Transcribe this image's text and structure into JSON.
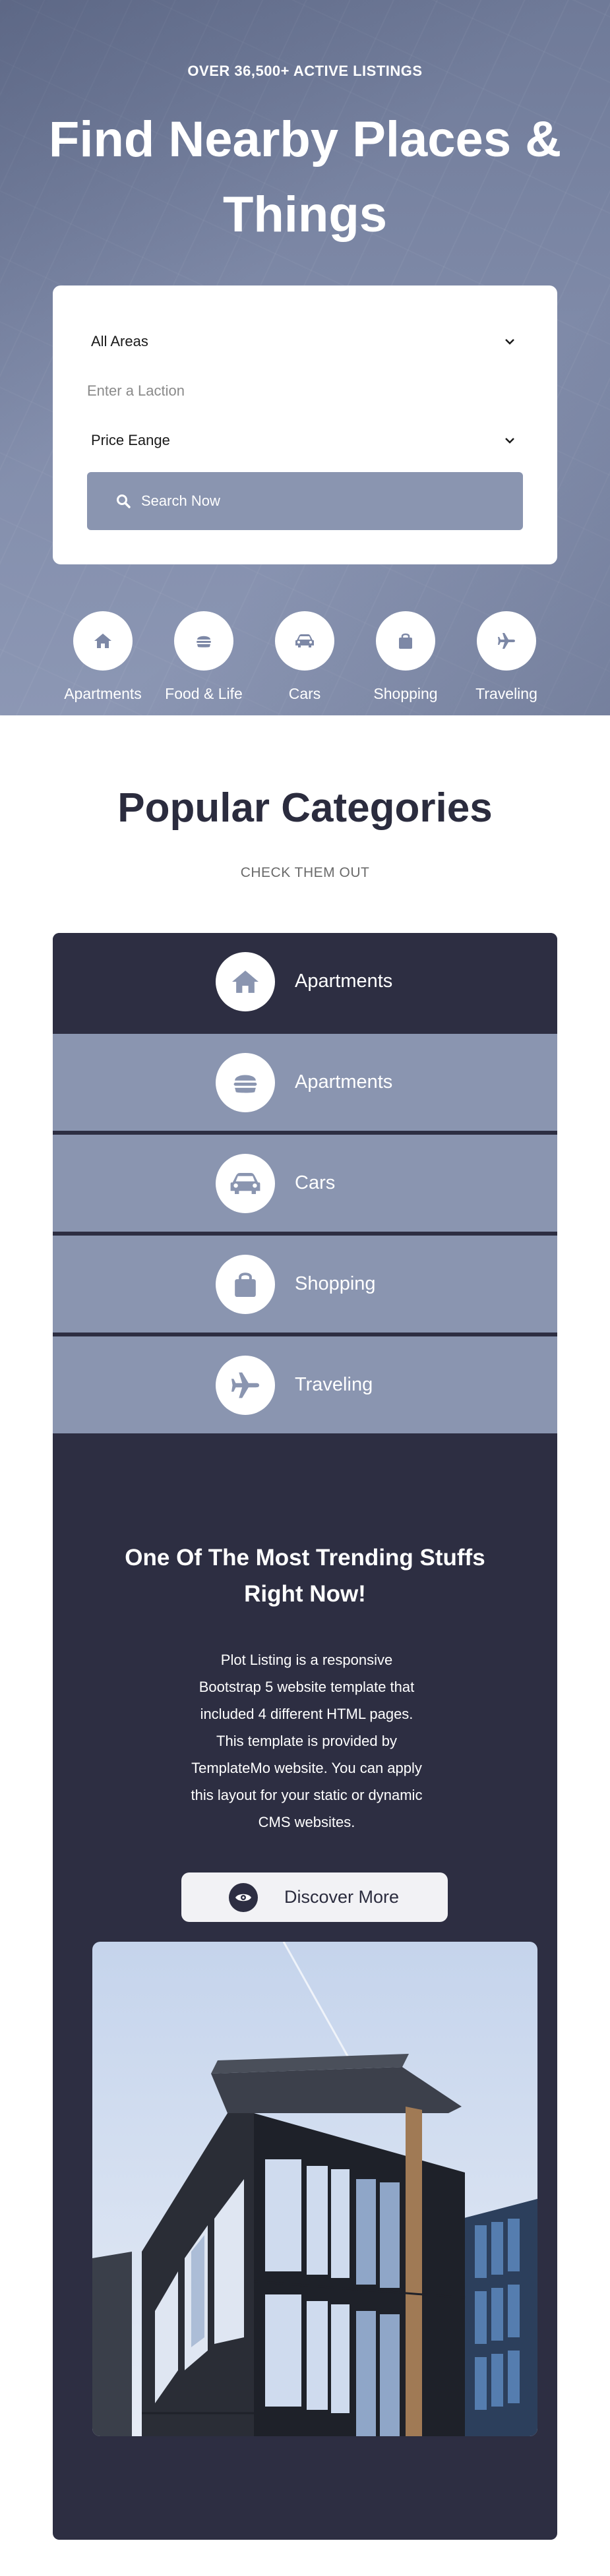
{
  "hero": {
    "eyebrow": "OVER 36,500+ ACTIVE LISTINGS",
    "title": "Find Nearby Places & Things"
  },
  "search_form": {
    "area_select": "All Areas",
    "location_placeholder": "Enter a Laction",
    "price_select": "Price Eange",
    "search_button": "Search Now"
  },
  "hero_categories": [
    {
      "label": "Apartments",
      "icon": "home-icon"
    },
    {
      "label": "Food & Life",
      "icon": "burger-icon"
    },
    {
      "label": "Cars",
      "icon": "car-icon"
    },
    {
      "label": "Shopping",
      "icon": "shopping-bag-icon"
    },
    {
      "label": "Traveling",
      "icon": "plane-icon"
    }
  ],
  "popular": {
    "title": "Popular Categories",
    "subtitle": "CHECK THEM OUT",
    "tabs": [
      {
        "label": "Apartments",
        "icon": "home-icon",
        "active": true
      },
      {
        "label": "Apartments",
        "icon": "burger-icon",
        "active": false
      },
      {
        "label": "Cars",
        "icon": "car-icon",
        "active": false
      },
      {
        "label": "Shopping",
        "icon": "shopping-bag-icon",
        "active": false
      },
      {
        "label": "Traveling",
        "icon": "plane-icon",
        "active": false
      }
    ],
    "content": {
      "heading": "One Of The Most Trending Stuffs Right Now!",
      "body": "Plot Listing is a responsive Bootstrap 5 website template that included 4 different HTML pages. This template is provided by TemplateMo website. You can apply this layout for your static or dynamic CMS websites.",
      "button": "Discover More"
    }
  },
  "colors": {
    "dark_navy": "#2d2e42",
    "slate": "#8a95b0",
    "white": "#ffffff"
  }
}
